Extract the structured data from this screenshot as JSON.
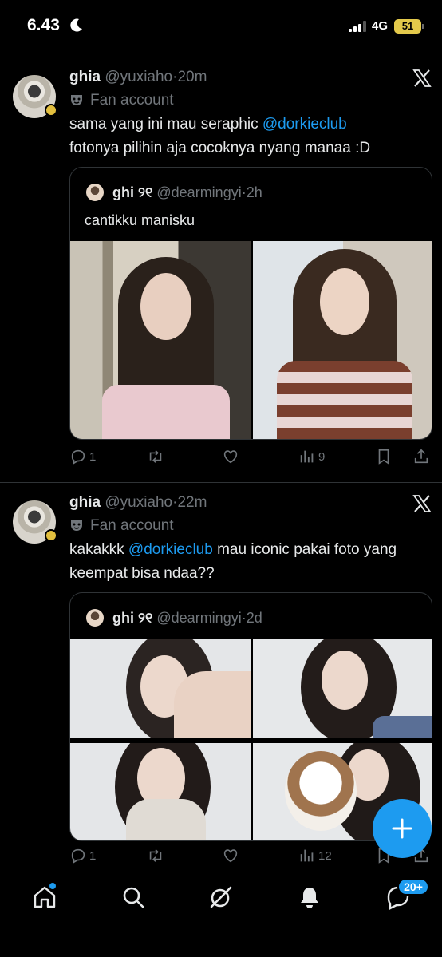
{
  "status_bar": {
    "time": "6.43",
    "network": "4G",
    "battery": "51"
  },
  "tweets": [
    {
      "name": "ghia",
      "handle": "@yuxiaho",
      "sep": "·",
      "time": "20m",
      "label": "Fan account",
      "text_before": "sama yang ini mau seraphic ",
      "mention": "@dorkieclub",
      "text_after": "fotonya pilihin aja cocoknya nyang manaa :D",
      "quote": {
        "name": "ghi",
        "name_symbol": "୨୧",
        "handle": "@dearmingyi",
        "sep": "·",
        "time": "2h",
        "text": "cantikku manisku"
      },
      "stats": {
        "replies": "1",
        "retweets": "",
        "likes": "",
        "views": "9"
      }
    },
    {
      "name": "ghia",
      "handle": "@yuxiaho",
      "sep": "·",
      "time": "22m",
      "label": "Fan account",
      "text_before": "kakakkk ",
      "mention": "@dorkieclub",
      "text_after": " mau iconic pakai foto yang keempat bisa ndaa??",
      "quote": {
        "name": "ghi",
        "name_symbol": "୨୧",
        "handle": "@dearmingyi",
        "sep": "·",
        "time": "2d",
        "text": ""
      },
      "stats": {
        "replies": "1",
        "retweets": "",
        "likes": "",
        "views": "12"
      }
    }
  ],
  "bottom_nav": {
    "items": [
      "home-icon",
      "search-icon",
      "grok-icon",
      "notifications-icon",
      "messages-icon"
    ],
    "messages_badge": "20+"
  },
  "fab": {
    "icon": "plus-icon"
  },
  "colors": {
    "accent": "#1d9bf0",
    "muted": "#71767b",
    "divider": "#2f3336"
  }
}
